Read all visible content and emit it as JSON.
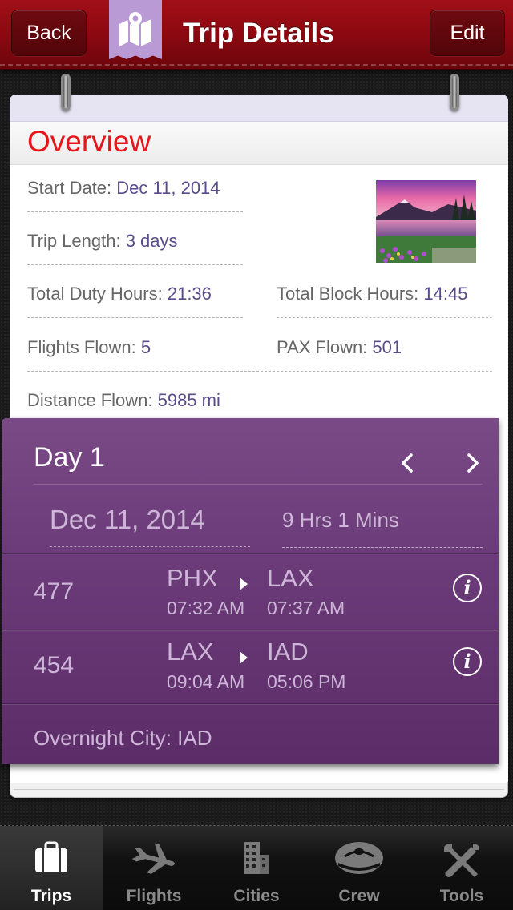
{
  "header": {
    "back_label": "Back",
    "title": "Trip Details",
    "edit_label": "Edit",
    "badge_icon": "map-pin-icon",
    "badge_color": "#b99ad4"
  },
  "overview": {
    "title": "Overview",
    "start_date_label": "Start Date: ",
    "start_date_value": "Dec 11, 2014",
    "trip_length_label": "Trip Length: ",
    "trip_length_value": "3 days",
    "total_duty_hours_label": "Total Duty Hours: ",
    "total_duty_hours_value": "21:36",
    "total_block_hours_label": "Total Block Hours: ",
    "total_block_hours_value": "14:45",
    "flights_flown_label": "Flights Flown: ",
    "flights_flown_value": "5",
    "pax_flown_label": "PAX Flown: ",
    "pax_flown_value": "501",
    "distance_flown_label": "Distance Flown: ",
    "distance_flown_value": "5985 mi",
    "title_color": "#e8141b"
  },
  "day": {
    "title": "Day 1",
    "prev_icon": "chevron-left-icon",
    "next_icon": "chevron-right-icon",
    "date": "Dec 11, 2014",
    "duration": "9 Hrs 1 Mins",
    "flights": [
      {
        "number": "477",
        "from": "PHX",
        "to": "LAX",
        "depart": "07:32 AM",
        "arrive": "07:37 AM"
      },
      {
        "number": "454",
        "from": "LAX",
        "to": "IAD",
        "depart": "09:04 AM",
        "arrive": "05:06 PM"
      }
    ],
    "overnight": "Overnight City: IAD",
    "panel_color": "#6d3d7b"
  },
  "tabs": [
    {
      "label": "Trips",
      "icon": "suitcase-icon",
      "active": true
    },
    {
      "label": "Flights",
      "icon": "airplane-icon",
      "active": false
    },
    {
      "label": "Cities",
      "icon": "buildings-icon",
      "active": false
    },
    {
      "label": "Crew",
      "icon": "pilot-cap-icon",
      "active": false
    },
    {
      "label": "Tools",
      "icon": "tools-icon",
      "active": false
    }
  ]
}
